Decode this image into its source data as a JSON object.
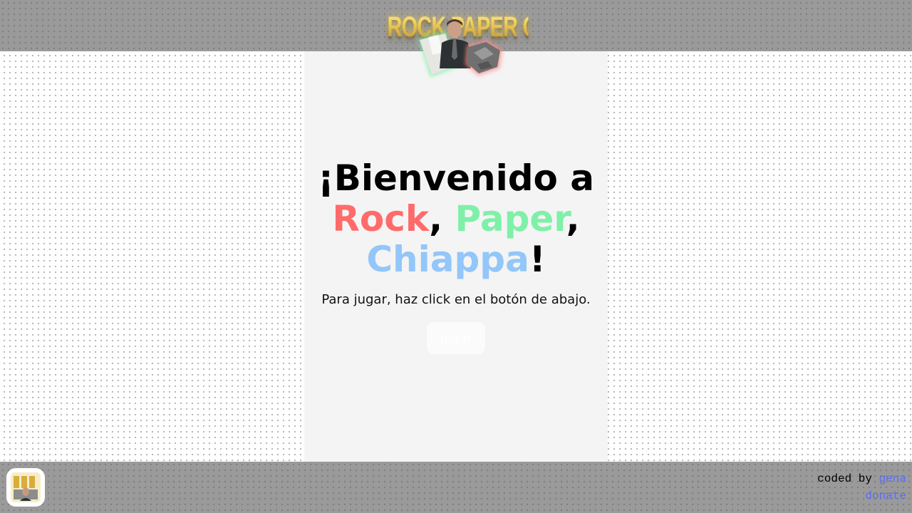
{
  "header": {
    "logo_title": "ROCK PAPER CHIAPPA"
  },
  "welcome": {
    "line1": "¡Bienvenido a",
    "rock": "Rock",
    "comma1": ",",
    "paper": "Paper",
    "comma2": ",",
    "chiappa": "Chiappa",
    "exclaim": "!"
  },
  "instructions": "Para jugar, haz click en el botón de abajo.",
  "play_button": {
    "label": "Jugar"
  },
  "footer": {
    "app_icon": "game-logo-icon",
    "credit_prefix": "coded by ",
    "author_link": "gena",
    "donate_link": "donate"
  },
  "colors": {
    "rock": "#ff6b6b",
    "paper": "#7ff0a8",
    "chiappa": "#93c6f9",
    "link": "#5b6cf2",
    "bar": "#9a9a9a",
    "panel": "#f4f4f4"
  }
}
